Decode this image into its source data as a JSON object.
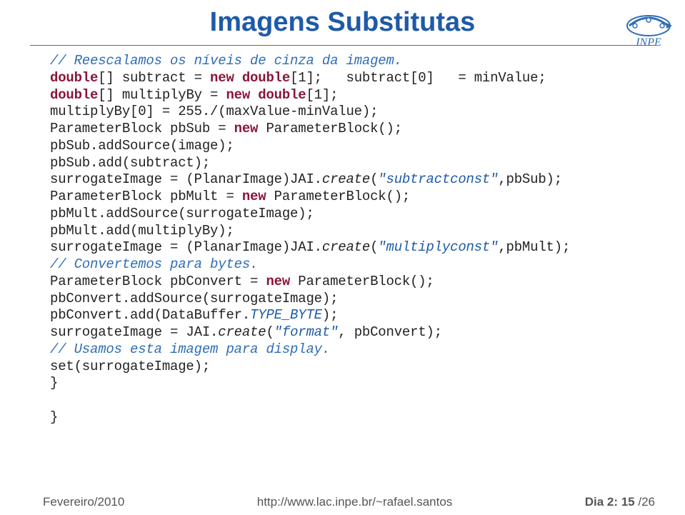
{
  "title": "Imagens Substitutas",
  "logo_label": "INPE",
  "code": {
    "c1": "// Reescalamos os níveis de cinza da imagem.",
    "l1a": "double",
    "l1b": "[] subtract = ",
    "l1c": "new",
    "l1d": " double",
    "l1e": "[1];   subtract[0]   = minValue;",
    "l2a": "double",
    "l2b": "[] multiplyBy = ",
    "l2c": "new",
    "l2d": " double",
    "l2e": "[1];",
    "l3": "multiplyBy[0] = 255./(maxValue-minValue);",
    "l4a": "ParameterBlock pbSub = ",
    "l4b": "new",
    "l4c": " ParameterBlock();",
    "l5": "pbSub.addSource(image);",
    "l6": "pbSub.add(subtract);",
    "l7a": "surrogateImage = (PlanarImage)JAI.",
    "l7b": "create",
    "l7c": "(",
    "l7d": "\"subtractconst\"",
    "l7e": ",pbSub);",
    "l8a": "ParameterBlock pbMult = ",
    "l8b": "new",
    "l8c": " ParameterBlock();",
    "l9": "pbMult.addSource(surrogateImage);",
    "l10": "pbMult.add(multiplyBy);",
    "l11a": "surrogateImage = (PlanarImage)JAI.",
    "l11b": "create",
    "l11c": "(",
    "l11d": "\"multiplyconst\"",
    "l11e": ",pbMult);",
    "c2": "// Convertemos para bytes.",
    "l12a": "ParameterBlock pbConvert = ",
    "l12b": "new",
    "l12c": " ParameterBlock();",
    "l13": "pbConvert.addSource(surrogateImage);",
    "l14a": "pbConvert.add(DataBuffer.",
    "l14b": "TYPE_BYTE",
    "l14c": ");",
    "l15a": "surrogateImage = JAI.",
    "l15b": "create",
    "l15c": "(",
    "l15d": "\"format\"",
    "l15e": ", pbConvert);",
    "c3": "// Usamos esta imagem para display.",
    "l16": "set(surrogateImage);",
    "l17": "}",
    "l18": "}"
  },
  "footer": {
    "left": "Fevereiro/2010",
    "center": "http://www.lac.inpe.br/~rafael.santos",
    "page_prefix": "Dia 2: ",
    "page_num": "15",
    "page_of": " /26"
  }
}
